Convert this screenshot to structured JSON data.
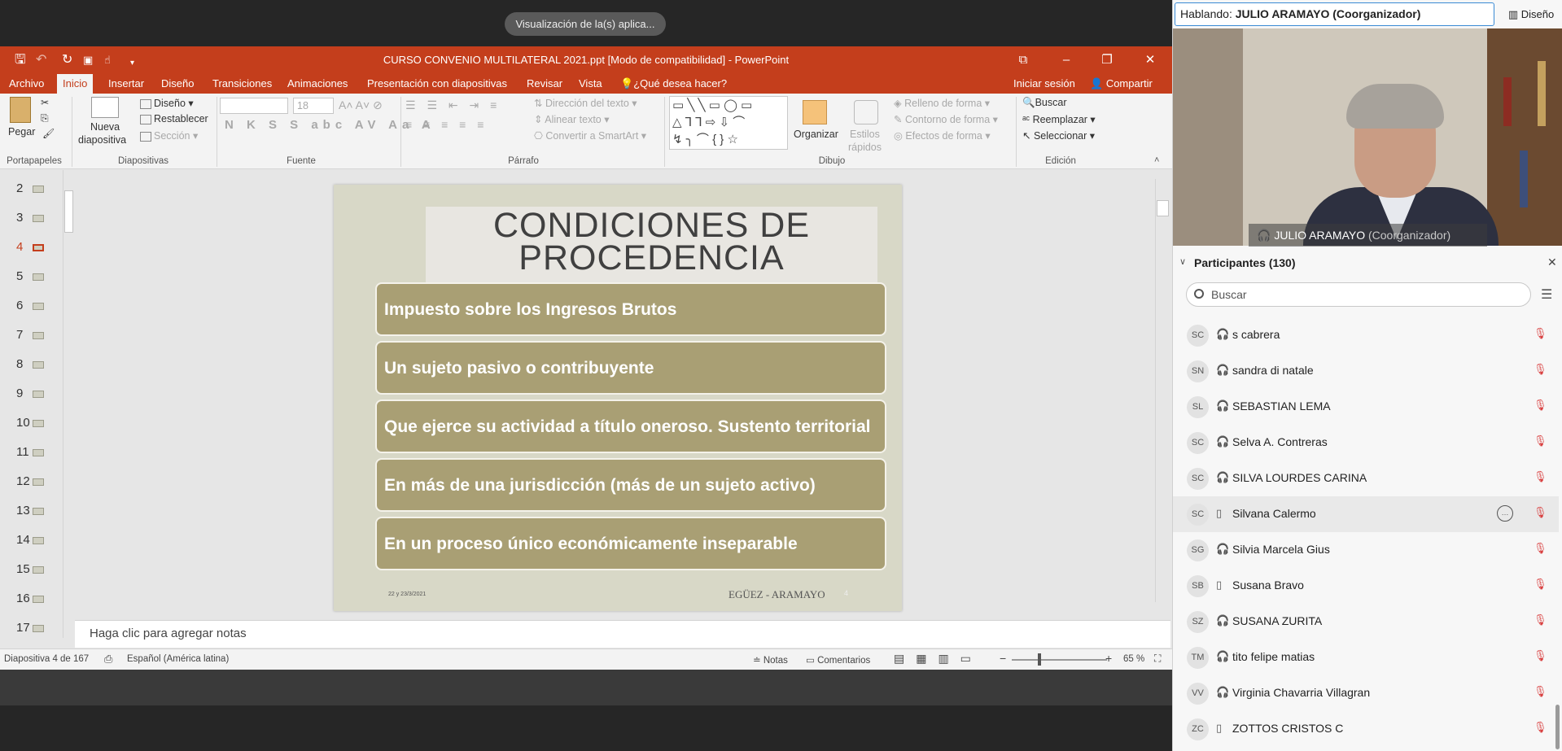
{
  "share_banner": "Visualización de la(s) aplica...",
  "ppt": {
    "title": "CURSO CONVENIO MULTILATERAL 2021.ppt [Modo de compatibilidad] - PowerPoint",
    "menu": [
      "Archivo",
      "Inicio",
      "Insertar",
      "Diseño",
      "Transiciones",
      "Animaciones",
      "Presentación con diapositivas",
      "Revisar",
      "Vista"
    ],
    "tell_me": "¿Qué desea hacer?",
    "sign_in": "Iniciar sesión",
    "share": "Compartir",
    "ribbon": {
      "paste": "Pegar",
      "new_slide_1": "Nueva",
      "new_slide_2": "diapositiva",
      "design": "Diseño",
      "reset": "Restablecer",
      "section": "Sección",
      "font_size": "18",
      "text_direction": "Dirección del texto",
      "align_text": "Alinear texto",
      "smartart": "Convertir a SmartArt",
      "arrange": "Organizar",
      "styles_1": "Estilos",
      "styles_2": "rápidos",
      "shape_fill": "Relleno de forma",
      "shape_outline": "Contorno de forma",
      "shape_effects": "Efectos de forma",
      "find": "Buscar",
      "replace": "Reemplazar",
      "select": "Seleccionar",
      "groups": {
        "clipboard": "Portapapeles",
        "slides": "Diapositivas",
        "font": "Fuente",
        "paragraph": "Párrafo",
        "drawing": "Dibujo",
        "editing": "Edición"
      }
    },
    "thumbnails": [
      "2",
      "3",
      "4",
      "5",
      "6",
      "7",
      "8",
      "9",
      "10",
      "11",
      "12",
      "13",
      "14",
      "15",
      "16",
      "17"
    ],
    "active_thumbnail": "4",
    "slide": {
      "title_line1": "CONDICIONES DE",
      "title_line2": "PROCEDENCIA",
      "items": [
        "Impuesto sobre los Ingresos Brutos",
        "Un sujeto pasivo o contribuyente",
        "Que ejerce su actividad a título oneroso. Sustento territorial",
        "En más de una jurisdicción (más de un sujeto activo)",
        "En un proceso único económicamente inseparable"
      ],
      "date": "22 y 23/3/2021",
      "footer": "EGÜEZ - ARAMAYO",
      "number": "4"
    },
    "notes_placeholder": "Haga clic para agregar notas",
    "status": {
      "slide_of": "Diapositiva 4 de 167",
      "language": "Español (América latina)",
      "notes": "Notas",
      "comments": "Comentarios",
      "zoom": "65 %"
    }
  },
  "webex": {
    "speaking_prefix": "Hablando:",
    "speaking_name": "JULIO ARAMAYO (Coorganizador)",
    "layout_button": "Diseño",
    "video_name": "JULIO ARAMAYO",
    "video_role": "(Coorganizador)",
    "participants_title": "Participantes (130)",
    "search_placeholder": "Buscar",
    "participants": [
      {
        "initials": "SC",
        "name": "s cabrera",
        "device": "headset-icon"
      },
      {
        "initials": "SN",
        "name": "sandra di natale",
        "device": "headset-icon"
      },
      {
        "initials": "SL",
        "name": "SEBASTIAN LEMA",
        "device": "headset-icon"
      },
      {
        "initials": "SC",
        "name": "Selva A. Contreras",
        "device": "headset-icon"
      },
      {
        "initials": "SC",
        "name": "SILVA LOURDES CARINA",
        "device": "headset-icon"
      },
      {
        "initials": "SC",
        "name": "Silvana Calermo",
        "device": "mobile-icon",
        "highlighted": true
      },
      {
        "initials": "SG",
        "name": "Silvia Marcela Gius",
        "device": "headset-icon"
      },
      {
        "initials": "SB",
        "name": "Susana Bravo",
        "device": "mobile-icon"
      },
      {
        "initials": "SZ",
        "name": "SUSANA ZURITA",
        "device": "headset-icon"
      },
      {
        "initials": "TM",
        "name": "tito felipe matias",
        "device": "headset-icon"
      },
      {
        "initials": "VV",
        "name": "Virginia Chavarria Villagran",
        "device": "headset-icon"
      },
      {
        "initials": "ZC",
        "name": "ZOTTOS CRISTOS C",
        "device": "mobile-icon"
      }
    ]
  },
  "colors": {
    "ppt_accent": "#c43e1c",
    "slide_item": "#a99f74",
    "slide_bg": "#d8d8c7",
    "muted_mic": "#d94040"
  }
}
